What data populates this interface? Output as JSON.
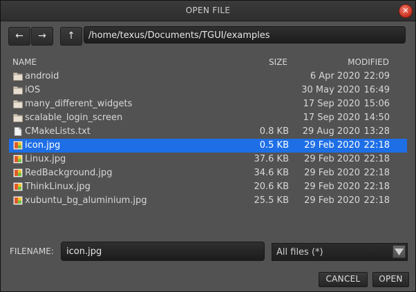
{
  "window": {
    "title": "OPEN FILE"
  },
  "nav": {
    "back": "←",
    "forward": "→",
    "up": "↑"
  },
  "path": "/home/texus/Documents/TGUI/examples",
  "columns": {
    "name": "NAME",
    "size": "SIZE",
    "modified": "MODIFIED"
  },
  "files": [
    {
      "name": "android",
      "size": "",
      "date": "6 Apr 2020",
      "time": "22:09",
      "type": "folder"
    },
    {
      "name": "iOS",
      "size": "",
      "date": "30 May 2020",
      "time": "16:49",
      "type": "folder"
    },
    {
      "name": "many_different_widgets",
      "size": "",
      "date": "17 Sep 2020",
      "time": "15:06",
      "type": "folder"
    },
    {
      "name": "scalable_login_screen",
      "size": "",
      "date": "17 Sep 2020",
      "time": "14:50",
      "type": "folder"
    },
    {
      "name": "CMakeLists.txt",
      "size": "0.8 KB",
      "date": "29 Aug 2020",
      "time": "13:28",
      "type": "text"
    },
    {
      "name": "icon.jpg",
      "size": "0.5 KB",
      "date": "29 Feb 2020",
      "time": "22:18",
      "type": "image",
      "selected": true
    },
    {
      "name": "Linux.jpg",
      "size": "37.6 KB",
      "date": "29 Feb 2020",
      "time": "22:18",
      "type": "image"
    },
    {
      "name": "RedBackground.jpg",
      "size": "34.6 KB",
      "date": "29 Feb 2020",
      "time": "22:18",
      "type": "image"
    },
    {
      "name": "ThinkLinux.jpg",
      "size": "20.6 KB",
      "date": "29 Feb 2020",
      "time": "22:18",
      "type": "image"
    },
    {
      "name": "xubuntu_bg_aluminium.jpg",
      "size": "25.5 KB",
      "date": "29 Feb 2020",
      "time": "22:18",
      "type": "image"
    }
  ],
  "filename": {
    "label": "FILENAME:",
    "value": "icon.jpg"
  },
  "filter": {
    "selected": "All files (*)"
  },
  "buttons": {
    "cancel": "CANCEL",
    "open": "OPEN"
  },
  "colors": {
    "selection": "#1e6fe6",
    "background": "#525252",
    "close": "#d9422f"
  }
}
